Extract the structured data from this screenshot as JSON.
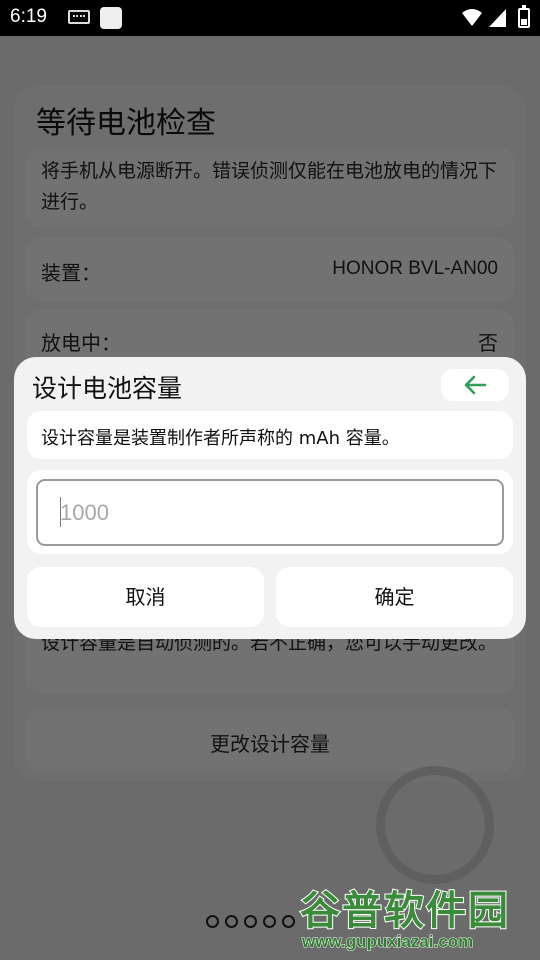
{
  "status_bar": {
    "time": "6:19"
  },
  "background": {
    "title": "等待电池检查",
    "notice": "将手机从电源断开。错误侦测仅能在电池放电的情况下进行。",
    "device_label": "装置：",
    "device_value": "HONOR BVL-AN00",
    "discharging_label": "放电中：",
    "discharging_value": "否",
    "auto_detect_text": "设计容量是自动侦测的。若不正确，您可以手动更改。",
    "change_capacity_button": "更改设计容量"
  },
  "dialog": {
    "title": "设计电池容量",
    "description": "设计容量是装置制作者所声称的 mAh 容量。",
    "input_placeholder": "1000",
    "input_value": "",
    "cancel_label": "取消",
    "ok_label": "确定"
  },
  "watermark": {
    "text": "谷普软件园",
    "url": "www.gupuxiazai.com"
  },
  "colors": {
    "accent_green": "#2e9e5b",
    "scrim": "#6b6b6b",
    "dialog_bg": "#f2f2f2"
  }
}
